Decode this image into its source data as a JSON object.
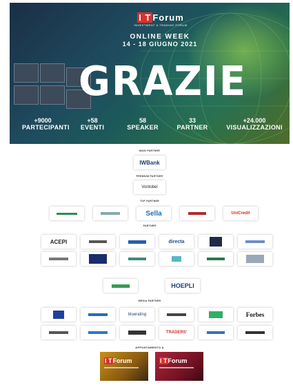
{
  "hero": {
    "logo_it": "I T",
    "logo_name": "Forum",
    "logo_sub": "INVESTMENT & TRADING FORUM",
    "week_line1": "ONLINE WEEK",
    "week_line2": "14 - 18 GIUGNO 2021",
    "headline": "GRAZIE"
  },
  "stats": [
    {
      "value": "+9000",
      "label": "PARTECIPANTI"
    },
    {
      "value": "+58",
      "label": "EVENTI"
    },
    {
      "value": "58",
      "label": "SPEAKER"
    },
    {
      "value": "33",
      "label": "PARTNER"
    },
    {
      "value": "+24.000",
      "label": "VISUALIZZAZIONI"
    }
  ],
  "sections": {
    "main_partner": "MAIN PARTNER",
    "premium_partner": "PREMIUM PARTNER",
    "top_partner": "TOP PARTNER",
    "partner": "PARTNER",
    "media_partner": "MEDIA PARTNER",
    "appuntamento": "APPUNTAMENTO A"
  },
  "logos": {
    "main": "IWBank",
    "premium": "Vontobel",
    "top": [
      "",
      "",
      "Sella",
      "",
      "UniCredit"
    ],
    "partner_row1": [
      "ACEPI",
      "",
      "",
      "directa",
      "",
      ""
    ],
    "partner_row2": [
      "",
      "",
      "",
      "",
      "",
      ""
    ],
    "mid": [
      "",
      "HOEPLI"
    ],
    "media_row1": [
      "",
      "",
      "bluerating",
      "",
      "",
      "Forbes"
    ],
    "media_row2": [
      "",
      "",
      "",
      "TRADERS'",
      "",
      ""
    ]
  },
  "appointments": [
    {
      "it": "I T",
      "name": "Forum"
    },
    {
      "it": "I T",
      "name": "Forum"
    }
  ],
  "colors": {
    "brand_red": "#d8322c",
    "sella_blue": "#1e6fb8",
    "unicredit_red": "#d52b1e",
    "forbes": "#111111"
  }
}
